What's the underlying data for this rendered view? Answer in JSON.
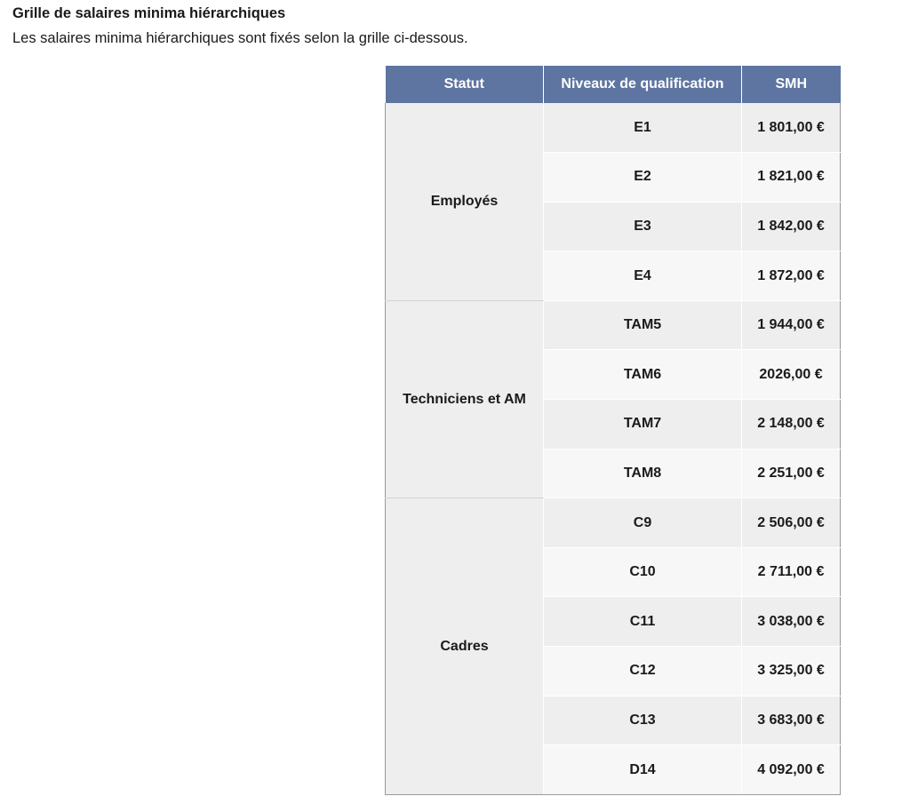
{
  "heading": {
    "title": "Grille de salaires minima hiérarchiques",
    "intro": "Les salaires minima hiérarchiques sont fixés selon la grille ci-dessous."
  },
  "table": {
    "headers": {
      "statut": "Statut",
      "niveau": "Niveaux de qualification",
      "smh": "SMH"
    },
    "groups": [
      {
        "statut": "Employés",
        "rows": [
          {
            "niveau": "E1",
            "smh": "1 801,00 €"
          },
          {
            "niveau": "E2",
            "smh": "1 821,00 €"
          },
          {
            "niveau": "E3",
            "smh": "1 842,00 €"
          },
          {
            "niveau": "E4",
            "smh": "1 872,00 €"
          }
        ]
      },
      {
        "statut": "Techniciens et AM",
        "rows": [
          {
            "niveau": "TAM5",
            "smh": "1 944,00 €"
          },
          {
            "niveau": "TAM6",
            "smh": "2026,00 €"
          },
          {
            "niveau": "TAM7",
            "smh": "2 148,00 €"
          },
          {
            "niveau": "TAM8",
            "smh": "2 251,00 €"
          }
        ]
      },
      {
        "statut": "Cadres",
        "rows": [
          {
            "niveau": "C9",
            "smh": "2 506,00 €"
          },
          {
            "niveau": "C10",
            "smh": "2 711,00 €"
          },
          {
            "niveau": "C11",
            "smh": "3 038,00 €"
          },
          {
            "niveau": "C12",
            "smh": "3 325,00 €"
          },
          {
            "niveau": "C13",
            "smh": "3 683,00 €"
          },
          {
            "niveau": "D14",
            "smh": "4 092,00 €"
          }
        ]
      }
    ]
  },
  "colors": {
    "header_bg": "#5e75a1",
    "row_shade_a": "#eeeeee",
    "row_shade_b": "#f7f7f7"
  }
}
